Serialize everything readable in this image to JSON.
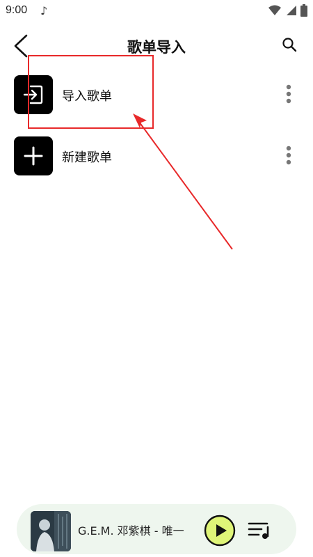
{
  "status_bar": {
    "time": "9:00",
    "icons": [
      "music-note-icon",
      "wifi-icon",
      "signal-icon",
      "battery-icon"
    ]
  },
  "header": {
    "title": "歌单导入",
    "back_icon": "chevron-left-icon",
    "search_icon": "search-icon"
  },
  "list": {
    "items": [
      {
        "label": "导入歌单",
        "icon": "import-icon",
        "tile_color": "#000000"
      },
      {
        "label": "新建歌单",
        "icon": "plus-icon",
        "tile_color": "#000000"
      }
    ]
  },
  "annotation": {
    "color": "#e8292a"
  },
  "player": {
    "track": "G.E.M. 邓紫棋 - 唯一",
    "play_button_color": "#dff578",
    "background": "#eef6ee"
  }
}
